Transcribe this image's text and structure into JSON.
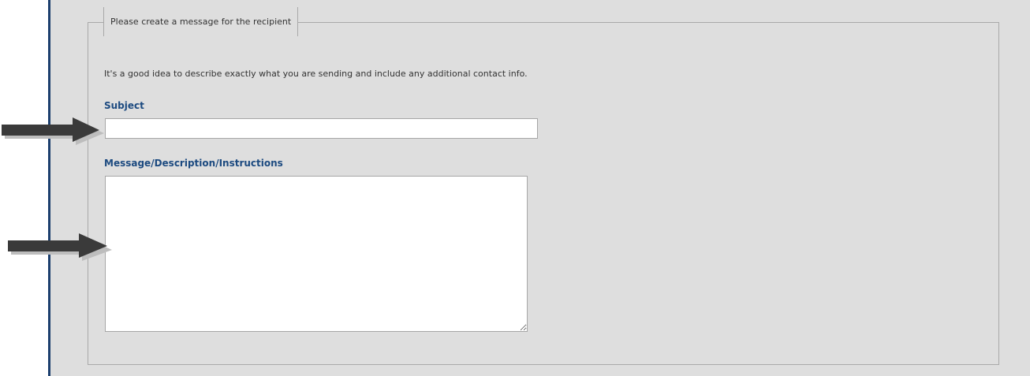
{
  "fieldset": {
    "legend": "Please create a message for the recipient",
    "hint": "It's a good idea to describe exactly what you are sending and include any additional contact info."
  },
  "subject": {
    "label": "Subject",
    "value": "",
    "placeholder": ""
  },
  "message": {
    "label": "Message/Description/Instructions",
    "value": "",
    "placeholder": ""
  },
  "colors": {
    "panel_background": "#dedede",
    "left_border": "#1c3f6e",
    "label_color": "#1c4a80",
    "arrow_color": "#3a3a3a"
  },
  "icons": {
    "subject_pointer": "arrow-right-icon",
    "message_pointer": "arrow-right-icon"
  }
}
